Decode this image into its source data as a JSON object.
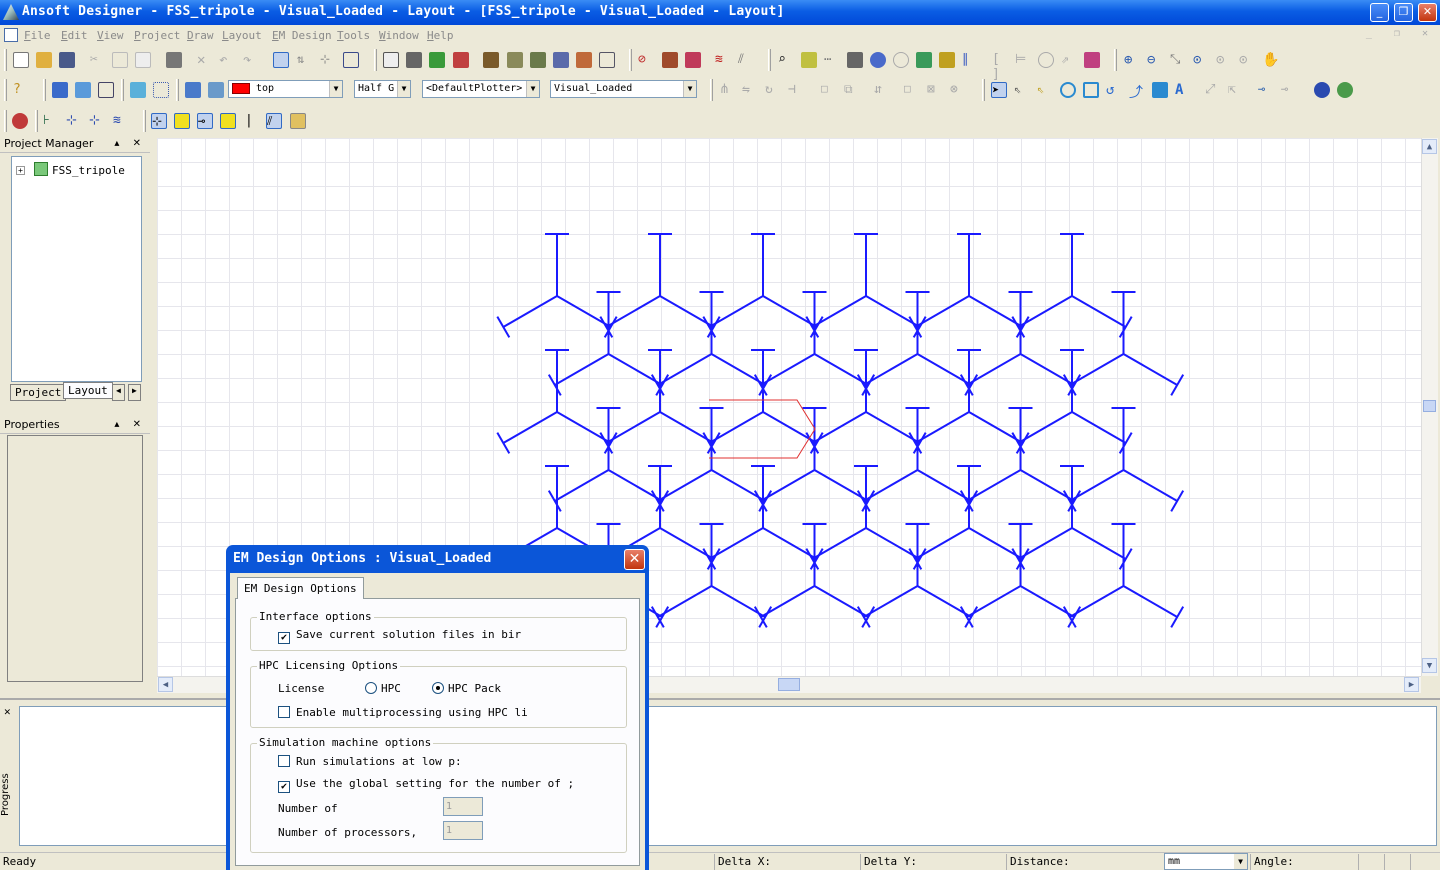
{
  "window": {
    "title": "Ansoft Designer - FSS_tripole - Visual_Loaded - Layout - [FSS_tripole - Visual_Loaded - Layout]",
    "minimize": "_",
    "restore": "❐",
    "close": "✕"
  },
  "menu": [
    "File",
    "Edit",
    "View",
    "Project",
    "Draw",
    "Layout",
    "EM Design",
    "Tools",
    "Window",
    "Help"
  ],
  "toolbar": {
    "layer_name": "top",
    "grid_mode": "Half G",
    "plotter": "<DefaultPlotter>",
    "design": "Visual_Loaded",
    "layer_color": "#ff0000"
  },
  "project_manager": {
    "title": "Project Manager",
    "tree_root": "FSS_tripole",
    "tabs": [
      "Project",
      "Layout"
    ]
  },
  "properties": {
    "title": "Properties"
  },
  "canvas": {
    "pattern_color": "#1a1aff"
  },
  "messages": {
    "progress_label": "Progress"
  },
  "status": {
    "ready": "Ready",
    "delta_x": "Delta X:",
    "delta_y": "Delta Y:",
    "distance": "Distance:",
    "units": "mm",
    "angle": "Angle:"
  },
  "dialog": {
    "title": "EM Design Options : Visual_Loaded",
    "tab": "EM Design Options",
    "interface_group": "Interface options",
    "save_binary": "Save current solution files in bir",
    "save_binary_checked": true,
    "hpc_group": "HPC Licensing Options",
    "license_label": "License",
    "license_hpc": "HPC",
    "license_hpc_pack": "HPC Pack",
    "selected_license": "HPC Pack",
    "enable_mp": "Enable multiprocessing using HPC li",
    "enable_mp_checked": false,
    "sim_group": "Simulation machine options",
    "low_priority": "Run simulations at low p:",
    "low_priority_checked": false,
    "global_setting": "Use the global setting for the number of ;",
    "global_setting_checked": true,
    "num_of_label": "Number of",
    "num_of_value": "1",
    "num_processors_label": "Number of processors,",
    "num_processors_value": "1"
  }
}
